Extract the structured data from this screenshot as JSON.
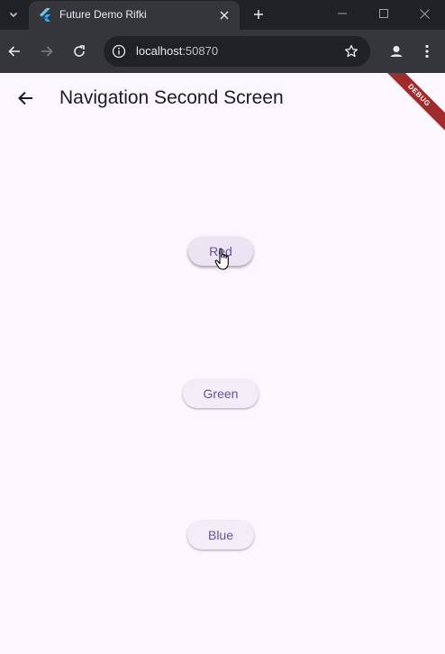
{
  "browser": {
    "tab": {
      "title": "Future Demo Rifki"
    },
    "address": {
      "host": "localhost",
      "port": ":50870"
    }
  },
  "icons": {
    "tab_search": "chevron-down-icon",
    "favicon": "flutter-icon",
    "close": "close-icon",
    "new_tab": "plus-icon",
    "back": "arrow-left-icon",
    "forward": "arrow-right-icon",
    "reload": "reload-icon",
    "info": "info-icon",
    "bookmark": "star-icon",
    "profile": "profile-icon",
    "menu": "kebab-menu-icon",
    "cursor": "hand-pointer-icon"
  },
  "app": {
    "title": "Navigation Second Screen",
    "debug_banner": "DEBUG",
    "buttons": [
      {
        "label": "Red"
      },
      {
        "label": "Green"
      },
      {
        "label": "Blue"
      }
    ]
  },
  "colors": {
    "app_background": "#fdf7ff",
    "button_background": "#f3edf7",
    "button_text": "#6750a4",
    "debug_banner": "#a02b2b"
  }
}
